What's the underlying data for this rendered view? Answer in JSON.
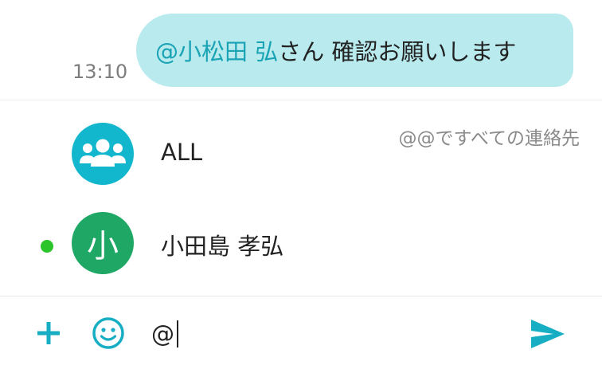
{
  "conversation": {
    "message": {
      "mention": "@小松田 弘",
      "text": " さん 確認お願いします",
      "time": "13:10"
    }
  },
  "mention_suggestions": {
    "hint": "@@ですべての連絡先",
    "items": [
      {
        "name": "ALL",
        "avatar": "group-icon"
      },
      {
        "name": "小田島 孝弘",
        "avatar_initial": "小",
        "status": "online"
      }
    ]
  },
  "composer": {
    "value": "@"
  },
  "colors": {
    "accent": "#1aa3b4",
    "bubble": "#b9ebee",
    "group_avatar": "#12b7cd",
    "user_avatar": "#1fa765",
    "online": "#2bc42b"
  }
}
